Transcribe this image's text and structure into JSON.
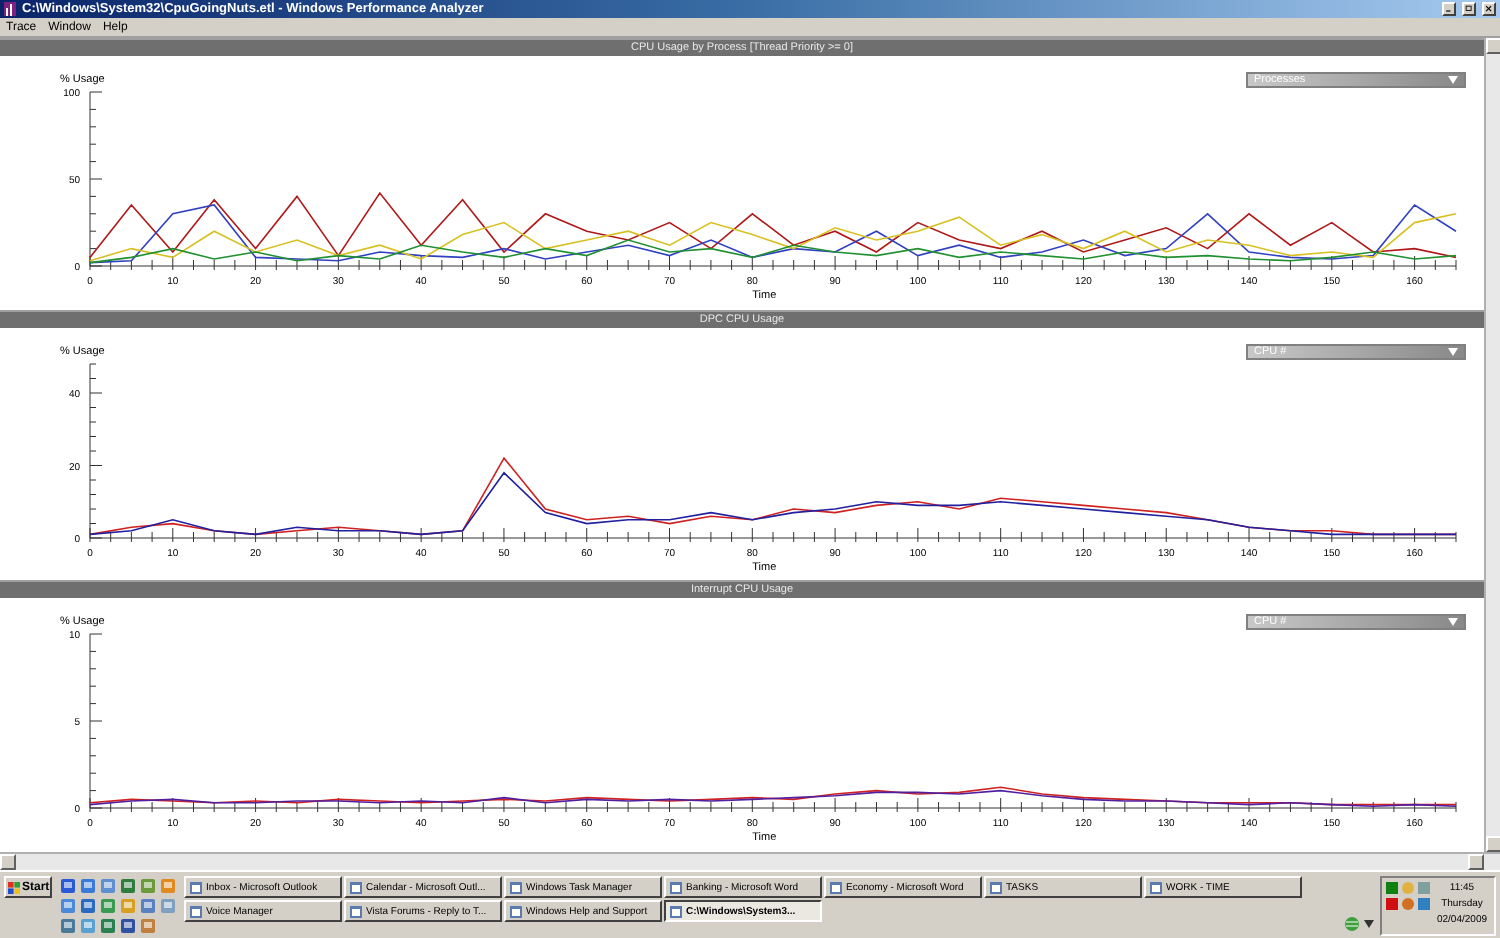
{
  "window": {
    "title": "C:\\Windows\\System32\\CpuGoingNuts.etl - Windows Performance Analyzer"
  },
  "menu": [
    "Trace",
    "Window",
    "Help"
  ],
  "panels": [
    {
      "title": "CPU Usage by Process [Thread Priority >= 0]",
      "dropdown": "Processes",
      "chart_data": {
        "type": "line",
        "xlabel": "Time",
        "ylabel": "% Usage",
        "xlim": [
          0,
          165
        ],
        "ylim": [
          0,
          100
        ],
        "xticks": [
          0,
          10,
          20,
          30,
          40,
          50,
          60,
          70,
          80,
          90,
          100,
          110,
          120,
          130,
          140,
          150,
          160
        ],
        "yticks": [
          0,
          50,
          100
        ],
        "x": [
          0,
          5,
          10,
          15,
          20,
          25,
          30,
          35,
          40,
          45,
          50,
          55,
          60,
          65,
          70,
          75,
          80,
          85,
          90,
          95,
          100,
          105,
          110,
          115,
          120,
          125,
          130,
          135,
          140,
          145,
          150,
          155,
          160,
          165
        ],
        "series": [
          {
            "color": "#b01818",
            "values": [
              5,
              35,
              8,
              38,
              10,
              40,
              6,
              42,
              12,
              38,
              8,
              30,
              20,
              15,
              25,
              10,
              30,
              12,
              20,
              8,
              25,
              15,
              10,
              20,
              8,
              15,
              22,
              10,
              30,
              12,
              25,
              8,
              10,
              5
            ]
          },
          {
            "color": "#3040c0",
            "values": [
              2,
              3,
              30,
              35,
              5,
              4,
              3,
              8,
              6,
              5,
              10,
              4,
              8,
              12,
              6,
              15,
              5,
              10,
              8,
              20,
              6,
              12,
              5,
              8,
              15,
              6,
              10,
              30,
              8,
              5,
              4,
              6,
              35,
              20
            ]
          },
          {
            "color": "#d8c020",
            "values": [
              3,
              10,
              5,
              20,
              8,
              15,
              6,
              12,
              4,
              18,
              25,
              10,
              15,
              20,
              12,
              25,
              18,
              10,
              22,
              15,
              20,
              28,
              12,
              18,
              10,
              20,
              8,
              15,
              12,
              6,
              8,
              5,
              25,
              30
            ]
          },
          {
            "color": "#209030",
            "values": [
              2,
              5,
              10,
              4,
              8,
              3,
              6,
              4,
              12,
              8,
              5,
              10,
              6,
              15,
              8,
              10,
              5,
              12,
              8,
              6,
              10,
              5,
              8,
              6,
              4,
              8,
              5,
              6,
              4,
              3,
              5,
              8,
              4,
              6
            ]
          }
        ]
      }
    },
    {
      "title": "DPC CPU Usage",
      "dropdown": "CPU #",
      "chart_data": {
        "type": "line",
        "xlabel": "Time",
        "ylabel": "% Usage",
        "xlim": [
          0,
          165
        ],
        "ylim": [
          0,
          48
        ],
        "xticks": [
          0,
          10,
          20,
          30,
          40,
          50,
          60,
          70,
          80,
          90,
          100,
          110,
          120,
          130,
          140,
          150,
          160
        ],
        "yticks": [
          0,
          20,
          40
        ],
        "x": [
          0,
          5,
          10,
          15,
          20,
          25,
          30,
          35,
          40,
          45,
          50,
          55,
          60,
          65,
          70,
          75,
          80,
          85,
          90,
          95,
          100,
          105,
          110,
          115,
          120,
          125,
          130,
          135,
          140,
          145,
          150,
          155,
          160,
          165
        ],
        "series": [
          {
            "color": "#d02020",
            "values": [
              1,
              3,
              4,
              2,
              1,
              2,
              3,
              2,
              1,
              2,
              22,
              8,
              5,
              6,
              4,
              6,
              5,
              8,
              7,
              9,
              10,
              8,
              11,
              10,
              9,
              8,
              7,
              5,
              3,
              2,
              2,
              1,
              1,
              1
            ]
          },
          {
            "color": "#2020a0",
            "values": [
              1,
              2,
              5,
              2,
              1,
              3,
              2,
              2,
              1,
              2,
              18,
              7,
              4,
              5,
              5,
              7,
              5,
              7,
              8,
              10,
              9,
              9,
              10,
              9,
              8,
              7,
              6,
              5,
              3,
              2,
              1,
              1,
              1,
              1
            ]
          }
        ]
      }
    },
    {
      "title": "Interrupt CPU Usage",
      "dropdown": "CPU #",
      "chart_data": {
        "type": "line",
        "xlabel": "Time",
        "ylabel": "% Usage",
        "xlim": [
          0,
          165
        ],
        "ylim": [
          0,
          10
        ],
        "xticks": [
          0,
          10,
          20,
          30,
          40,
          50,
          60,
          70,
          80,
          90,
          100,
          110,
          120,
          130,
          140,
          150,
          160
        ],
        "yticks": [
          0,
          5,
          10
        ],
        "x": [
          0,
          5,
          10,
          15,
          20,
          25,
          30,
          35,
          40,
          45,
          50,
          55,
          60,
          65,
          70,
          75,
          80,
          85,
          90,
          95,
          100,
          105,
          110,
          115,
          120,
          125,
          130,
          135,
          140,
          145,
          150,
          155,
          160,
          165
        ],
        "series": [
          {
            "color": "#d02020",
            "values": [
              0.3,
              0.5,
              0.4,
              0.3,
              0.4,
              0.3,
              0.5,
              0.4,
              0.3,
              0.4,
              0.5,
              0.4,
              0.6,
              0.5,
              0.4,
              0.5,
              0.6,
              0.5,
              0.8,
              1.0,
              0.8,
              0.9,
              1.2,
              0.8,
              0.6,
              0.5,
              0.4,
              0.3,
              0.3,
              0.3,
              0.2,
              0.2,
              0.2,
              0.2
            ]
          },
          {
            "color": "#5020a0",
            "values": [
              0.2,
              0.4,
              0.5,
              0.3,
              0.3,
              0.4,
              0.4,
              0.3,
              0.4,
              0.3,
              0.6,
              0.3,
              0.5,
              0.4,
              0.5,
              0.4,
              0.5,
              0.6,
              0.7,
              0.9,
              0.9,
              0.8,
              1.0,
              0.7,
              0.5,
              0.4,
              0.4,
              0.3,
              0.2,
              0.3,
              0.2,
              0.1,
              0.2,
              0.1
            ]
          }
        ]
      }
    }
  ],
  "taskbar": {
    "start": "Start",
    "buttons": [
      {
        "label": "Inbox - Microsoft Outlook",
        "selected": false
      },
      {
        "label": "Calendar - Microsoft Outl...",
        "selected": false
      },
      {
        "label": "Windows Task Manager",
        "selected": false
      },
      {
        "label": "Banking - Microsoft Word",
        "selected": false
      },
      {
        "label": "Economy - Microsoft Word",
        "selected": false
      },
      {
        "label": "TASKS",
        "selected": false
      },
      {
        "label": "WORK - TIME",
        "selected": false
      },
      {
        "label": "Voice Manager",
        "selected": false
      },
      {
        "label": "Vista Forums - Reply to T...",
        "selected": false
      },
      {
        "label": "Windows Help and Support",
        "selected": false
      },
      {
        "label": "C:\\Windows\\System3...",
        "selected": true
      }
    ],
    "clock": {
      "time": "11:45",
      "day": "Thursday",
      "date": "02/04/2009"
    }
  }
}
